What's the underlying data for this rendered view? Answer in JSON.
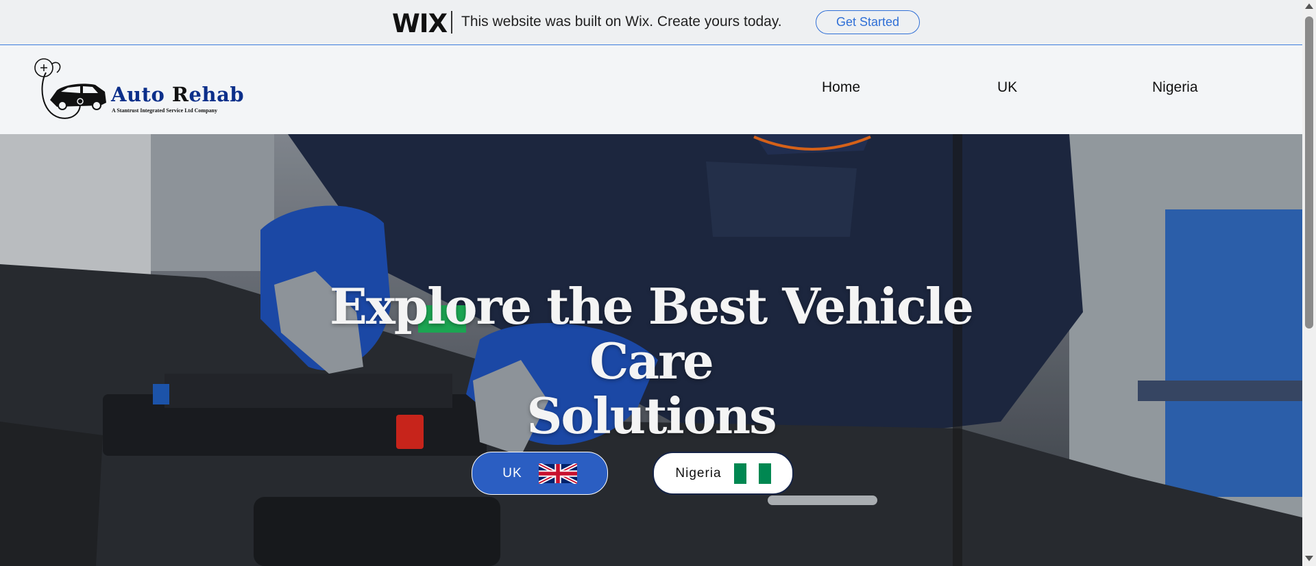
{
  "wix_banner": {
    "logo": "WIX",
    "message": "This website was built on Wix. Create yours today.",
    "cta_label": "Get Started"
  },
  "header": {
    "logo": {
      "name_part1": "Auto ",
      "name_part2": "Rehab",
      "tagline": "A Stantrust Integrated Service Ltd Company"
    },
    "nav": [
      "Home",
      "UK",
      "Nigeria"
    ]
  },
  "hero": {
    "title_line1": "Explore the Best Vehicle Care",
    "title_line2": "Solutions",
    "buttons": {
      "uk_label": "UK",
      "nigeria_label": "Nigeria"
    }
  },
  "colors": {
    "accent_blue": "#2b5ec2",
    "banner_link": "#2f6fd6",
    "logo_blue": "#0c2f8a",
    "nigeria_green": "#008751"
  },
  "icons": [
    "stethoscope-car-logo",
    "uk-flag-icon",
    "nigeria-flag-icon"
  ]
}
